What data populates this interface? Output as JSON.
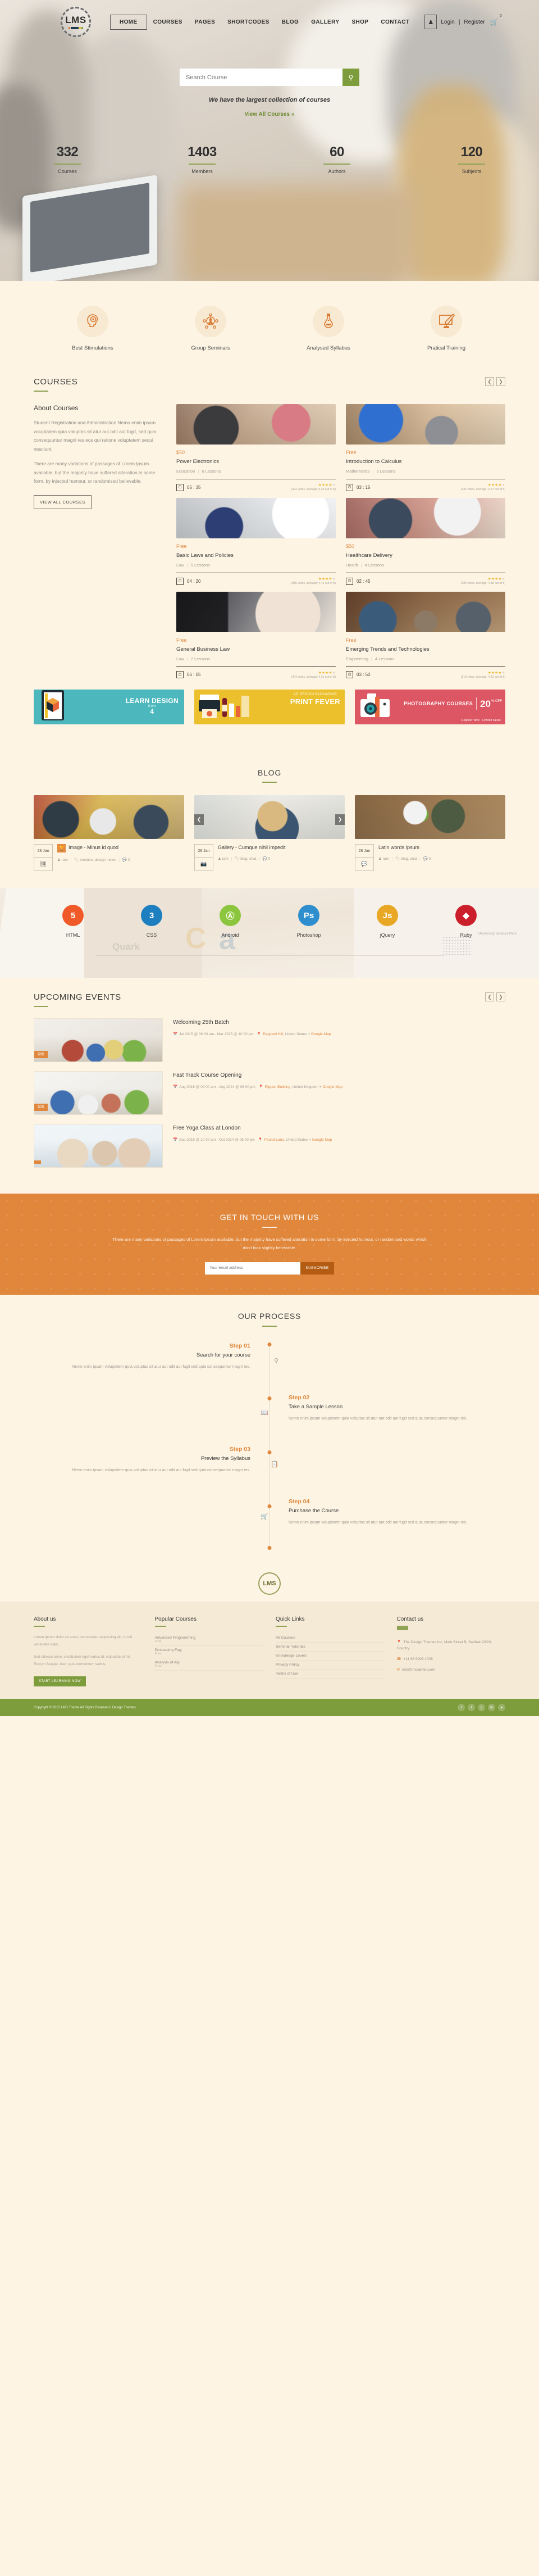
{
  "brand": {
    "logo_text": "LMS",
    "footer_logo_text": "LMS"
  },
  "nav": {
    "items": [
      {
        "label": "HOME",
        "active": true
      },
      {
        "label": "COURSES",
        "active": false
      },
      {
        "label": "PAGES",
        "active": false
      },
      {
        "label": "SHORTCODES",
        "active": false
      },
      {
        "label": "BLOG",
        "active": false
      },
      {
        "label": "GALLERY",
        "active": false
      },
      {
        "label": "SHOP",
        "active": false
      },
      {
        "label": "CONTACT",
        "active": false
      }
    ],
    "user_icon": "user-icon",
    "login_label": "Login",
    "separator": "|",
    "register_label": "Register",
    "cart_icon": "cart-icon",
    "cart_count": "0"
  },
  "hero": {
    "search_placeholder": "Search Course",
    "search_icon": "search-icon",
    "tagline": "We have the largest collection of courses",
    "link_label": "View All Courses »",
    "accent": "#7d9c3c",
    "stats": [
      {
        "number": "332",
        "label": "Courses"
      },
      {
        "number": "1403",
        "label": "Members"
      },
      {
        "number": "60",
        "label": "Authors"
      },
      {
        "number": "120",
        "label": "Subjects"
      }
    ]
  },
  "features": [
    {
      "label": "Best Stimulations",
      "icon": "brain-head-icon"
    },
    {
      "label": "Group Seminars",
      "icon": "group-network-icon"
    },
    {
      "label": "Analysed Syllabus",
      "icon": "flask-icon"
    },
    {
      "label": "Pratical Training",
      "icon": "monitor-pen-icon"
    }
  ],
  "courses": {
    "title": "COURSES",
    "prev_icon": "chevron-left-icon",
    "next_icon": "chevron-right-icon",
    "about_title": "About Courses",
    "about_p1": "Student Registration and Administration Nemo enim ipsam voluptatem quia voluptas sit atur aut odit aut fugit, sed quia consequuntur magni res eos qui ratione voluptatem sequi nesciunt.",
    "about_p2": "There are many variations of passages of Lorem Ipsum available, but the majority have suffered alteration in some form, by injected humour, or randomised believable.",
    "view_all_label": "VIEW ALL COURSES",
    "cards": [
      {
        "price": "$50",
        "title": "Power Electronics",
        "category": "Education",
        "lessons": "6 Lessons",
        "time": "05 : 35",
        "clock_icon": "clock-icon",
        "stars": 4,
        "rating_text": "(422 votes, average: 4.33 out of 5)"
      },
      {
        "price": "Free",
        "title": "Introduction to Calculus",
        "category": "Mathematics",
        "lessons": "5 Lessons",
        "time": "03 : 15",
        "clock_icon": "clock-icon",
        "stars": 4,
        "rating_text": "(341 votes, average: 4.27 out of 5)"
      },
      {
        "price": "Free",
        "title": "Basic Laws and Policies",
        "category": "Law",
        "lessons": "5 Lessons",
        "time": "04 : 20",
        "clock_icon": "clock-icon",
        "stars": 4,
        "rating_text": "(386 votes, average: 4.41 out of 5)"
      },
      {
        "price": "$50",
        "title": "Healthcare Delivery",
        "category": "Health",
        "lessons": "4 Lessons",
        "time": "02 : 45",
        "clock_icon": "clock-icon",
        "stars": 4,
        "rating_text": "(295 votes, average: 4.18 out of 5)"
      },
      {
        "price": "Free",
        "title": "General Business Law",
        "category": "Law",
        "lessons": "7 Lessons",
        "time": "06 : 05",
        "clock_icon": "clock-icon",
        "stars": 4,
        "rating_text": "(404 votes, average: 4.31 out of 5)"
      },
      {
        "price": "Free",
        "title": "Emerging Trends and Technologies",
        "category": "Engineering",
        "lessons": "4 Lessons",
        "time": "03 : 50",
        "clock_icon": "clock-icon",
        "stars": 4,
        "rating_text": "(318 votes, average: 4.22 out of 5)"
      }
    ]
  },
  "promos": [
    {
      "title": "LEARN DESIGN",
      "sub": "from",
      "extra": "4",
      "color": "#4cb8bd",
      "name": "learn-design-banner"
    },
    {
      "title": "PRINT FEVER",
      "sub": "AD DESIGN PACKAGING",
      "extra": "",
      "color": "#ecc02c",
      "name": "print-fever-banner"
    },
    {
      "title": "PHOTOGRAPHY COURSES",
      "sub": "",
      "discount_number": "20",
      "discount_unit": "% OFF",
      "extra": "Register Now · Limited Seats",
      "color": "#dd5663",
      "name": "photography-courses-banner"
    }
  ],
  "blog": {
    "title": "BLOG",
    "prev_icon": "chevron-left-icon",
    "next_icon": "chevron-right-icon",
    "posts": [
      {
        "date": "28 Jan",
        "format_icon": "image-icon",
        "tag_icon": "trophy-icon",
        "title": "Image - Minus id quod",
        "author": "ram",
        "tags": "creative, design, news",
        "comments": "0"
      },
      {
        "date": "28 Jan",
        "format_icon": "camera-icon",
        "tag_icon": "",
        "title": "Gallery - Cumque nihil impedit",
        "author": "ram",
        "tags": "blog, chat",
        "comments": "0"
      },
      {
        "date": "28 Jan",
        "format_icon": "comment-icon",
        "tag_icon": "",
        "title": "Latin words Ipsum",
        "author": "ram",
        "tags": "blog, chat",
        "comments": "0"
      }
    ],
    "author_icon": "user-icon",
    "tag_icon": "tag-icon",
    "comment_icon": "comment-icon"
  },
  "tech": [
    {
      "label": "HTML",
      "glyph": "5",
      "color": "#f05a28",
      "icon": "html5-icon"
    },
    {
      "label": "CSS",
      "glyph": "3",
      "color": "#1d7fc0",
      "icon": "css3-icon"
    },
    {
      "label": "Android",
      "glyph": "Ⓐ",
      "color": "#8cc63e",
      "icon": "android-icon"
    },
    {
      "label": "Photoshop",
      "glyph": "Ps",
      "color": "#2f8fce",
      "icon": "photoshop-icon"
    },
    {
      "label": "jQuery",
      "glyph": "Js",
      "color": "#e8a825",
      "icon": "jquery-icon"
    },
    {
      "label": "Ruby",
      "glyph": "◆",
      "color": "#cc1f2c",
      "icon": "ruby-icon"
    }
  ],
  "tech_ghost": {
    "quark": "Quark",
    "a1": "C",
    "a2": "a",
    "uni": "University Science Park"
  },
  "events": {
    "title": "UPCOMING EVENTS",
    "prev_icon": "chevron-left-icon",
    "next_icon": "chevron-right-icon",
    "items": [
      {
        "price": "$60",
        "title": "Welcoming 25th Batch",
        "date": "Jul 2015 @ 08 00 am - Mar 2025 @ 10 00 pm",
        "venue": "Peppard Hill",
        "country": "United States",
        "map_label": "Google Map",
        "calendar_icon": "calendar-icon",
        "pin_icon": "map-pin-icon"
      },
      {
        "price": "$20",
        "title": "Fast Track Course Opening",
        "date": "Aug 2015 @ 09 00 am - Aug 2024 @ 06 00 pm",
        "venue": "Rippon Building",
        "country": "United Kingdom",
        "map_label": "Google Map",
        "calendar_icon": "calendar-icon",
        "pin_icon": "map-pin-icon"
      },
      {
        "price": "",
        "title": "Free Yoga Class at London",
        "date": "Sep 2019 @ 10 00 am - Oct 2024 @ 06 00 pm",
        "venue": "Pound Lane",
        "country": "United States",
        "map_label": "Google Map",
        "calendar_icon": "calendar-icon",
        "pin_icon": "map-pin-icon"
      }
    ]
  },
  "cta": {
    "title": "GET IN TOUCH WITH US",
    "text": "There are many variations of passages of Lorem Ipsum available, but the majority have suffered alteration in some form, by injected humour, or randomised words which don't look slightly believable.",
    "input_placeholder": "Your email address",
    "button_label": "SUBSCRIBE",
    "accent": "#e0873c"
  },
  "process": {
    "title": "OUR PROCESS",
    "steps": [
      {
        "num": "Step 01",
        "title": "Search for your course",
        "side": "left",
        "icon": "search-icon",
        "desc": "Nemo enim ipsam voluptatem quia voluptas sit atur aut odit aut fugit sed quia consequuntur magni res."
      },
      {
        "num": "Step 02",
        "title": "Take a Sample Lesson",
        "side": "right",
        "icon": "book-icon",
        "desc": "Nemo enim ipsam voluptatem quia voluptas sit atur aut odit aut fugit sed quia consequuntur magni res."
      },
      {
        "num": "Step 03",
        "title": "Preview the Syllabus",
        "side": "left",
        "icon": "list-icon",
        "desc": "Nemo enim ipsam voluptatem quia voluptas sit atur aut odit aut fugit sed quia consequuntur magni res."
      },
      {
        "num": "Step 04",
        "title": "Purchase the Course",
        "side": "right",
        "icon": "cart-icon",
        "desc": "Nemo enim ipsam voluptatem quia voluptas sit atur aut odit aut fugit sed quia consequuntur magni res."
      }
    ]
  },
  "footer": {
    "about": {
      "title": "About us",
      "p1": "Lorem ipsum dolor sit amet, consectetur adipiscing elit, id elit venenatis diam.",
      "p2": "Sed ultrices enim, vestibulum eget varius id, vulputate et mi. Rutrum feugiat, diam quis elementum varius.",
      "button_label": "START LEARNING NOW"
    },
    "popular": {
      "title": "Popular Courses",
      "items": [
        {
          "label": "Advanced Programming",
          "sub": "Free"
        },
        {
          "label": "Processing Fag.",
          "sub": "Free"
        },
        {
          "label": "Analysis of Alg.",
          "sub": "Free"
        }
      ]
    },
    "quick": {
      "title": "Quick Links",
      "items": [
        {
          "label": "All Courses",
          "sub": ""
        },
        {
          "label": "Seminar Tutorials",
          "sub": ""
        },
        {
          "label": "Knowledge Levels",
          "sub": ""
        },
        {
          "label": "Privacy Policy",
          "sub": ""
        },
        {
          "label": "Terms of Use",
          "sub": ""
        }
      ]
    },
    "contact": {
      "title": "Contact us",
      "address": "The Design Themes Inc, Main Street B, Sadhak 20/20, Country",
      "phone": "+11 88 9908 1008",
      "email": "info@lmsadmin.com",
      "phone_icon": "phone-icon",
      "email_icon": "mail-icon",
      "pin_icon": "map-pin-icon"
    },
    "copyright": "Copyright © 2015 LMS Theme All Rights Reserved | Design Themes",
    "socials": [
      {
        "name": "facebook-icon",
        "glyph": "f"
      },
      {
        "name": "twitter-icon",
        "glyph": "t"
      },
      {
        "name": "google-plus-icon",
        "glyph": "g"
      },
      {
        "name": "linkedin-icon",
        "glyph": "in"
      },
      {
        "name": "rss-icon",
        "glyph": "●"
      }
    ]
  }
}
